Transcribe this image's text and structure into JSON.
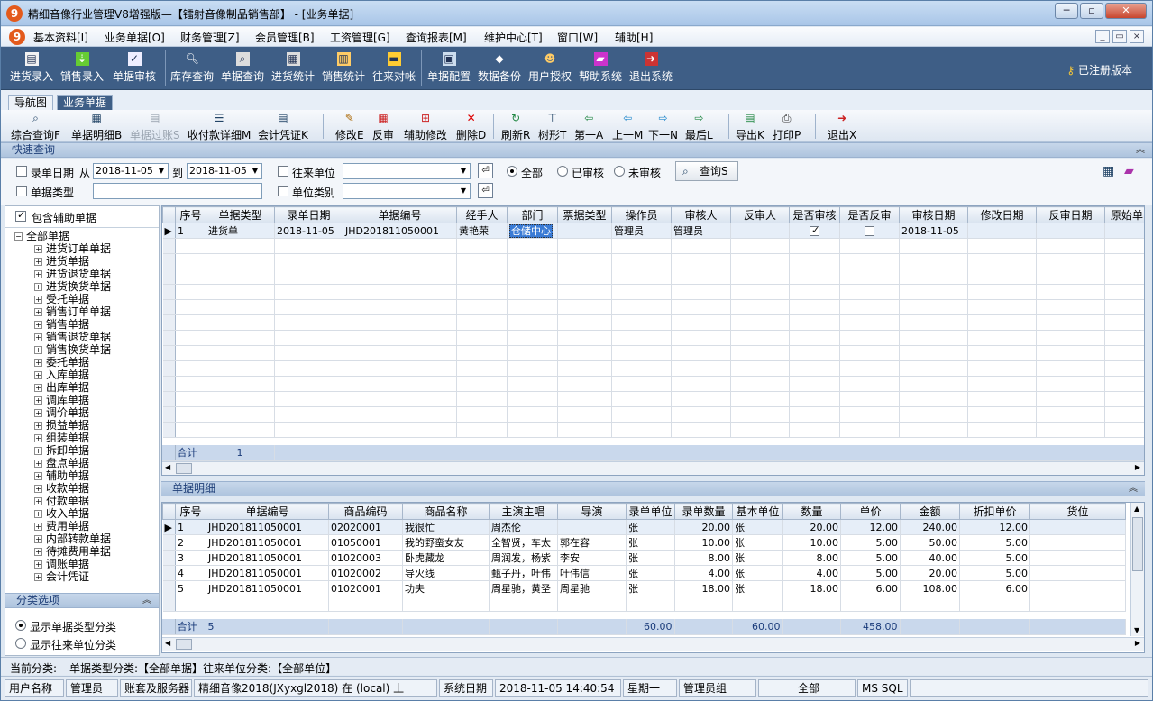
{
  "window": {
    "title": "精细音像行业管理V8增强版—【镭射音像制品销售部】 - [业务单据]",
    "app_icon": "9"
  },
  "menu": [
    "基本资料[I]",
    "业务单据[O]",
    "财务管理[Z]",
    "会员管理[B]",
    "工资管理[G]",
    "查询报表[M]",
    "维护中心[T]",
    "窗口[W]",
    "辅助[H]"
  ],
  "main_toolbar": [
    "进货录入",
    "销售录入",
    "单据审核",
    "库存查询",
    "单据查询",
    "进货统计",
    "销售统计",
    "往来对帐",
    "单据配置",
    "数据备份",
    "用户授权",
    "帮助系统",
    "退出系统"
  ],
  "registered_label": "已注册版本",
  "tabs": [
    "导航图",
    "业务单据"
  ],
  "doc_toolbar": [
    "综合查询F",
    "单据明细B",
    "单据过账S",
    "收付款详细M",
    "会计凭证K",
    "修改E",
    "反审",
    "辅助修改",
    "删除D",
    "刷新R",
    "树形T",
    "第一A",
    "上一M",
    "下一N",
    "最后L",
    "导出K",
    "打印P",
    "退出X"
  ],
  "quick_search": {
    "section_title": "快速查询",
    "date_label": "录单日期",
    "from_label": "从",
    "to_label": "到",
    "date_from": "2018-11-05",
    "date_to": "2018-11-05",
    "partner_label": "往来单位",
    "type_label": "单据类型",
    "unit_cat_label": "单位类别",
    "radio_all": "全部",
    "radio_audited": "已审核",
    "radio_unaudited": "未审核",
    "query_btn": "查询S"
  },
  "left_panel": {
    "include_aux": "包含辅助单据",
    "root": "全部单据",
    "items": [
      "进货订单单据",
      "进货单据",
      "进货退货单据",
      "进货换货单据",
      "受托单据",
      "销售订单单据",
      "销售单据",
      "销售退货单据",
      "销售换货单据",
      "委托单据",
      "入库单据",
      "出库单据",
      "调库单据",
      "调价单据",
      "损益单据",
      "组装单据",
      "拆卸单据",
      "盘点单据",
      "辅助单据",
      "收款单据",
      "付款单据",
      "收入单据",
      "费用单据",
      "内部转款单据",
      "待摊费用单据",
      "调账单据",
      "会计凭证"
    ],
    "category_title": "分类选项",
    "opt_type": "显示单据类型分类",
    "opt_partner": "显示往来单位分类"
  },
  "main_grid": {
    "columns": [
      "序号",
      "单据类型",
      "录单日期",
      "单据编号",
      "经手人",
      "部门",
      "票据类型",
      "操作员",
      "审核人",
      "反审人",
      "是否审核",
      "是否反审",
      "审核日期",
      "修改日期",
      "反审日期",
      "原始单"
    ],
    "row": {
      "no": "1",
      "type": "进货单",
      "date": "2018-11-05",
      "code": "JHD201811050001",
      "handler": "黄艳荣",
      "dept": "仓储中心",
      "bill_type": "",
      "operator": "管理员",
      "auditor": "管理员",
      "reverse": "",
      "audited": true,
      "reversed": false,
      "audit_date": "2018-11-05"
    },
    "sum_label": "合计",
    "sum_value": "1"
  },
  "detail": {
    "section_title": "单据明细",
    "columns": [
      "序号",
      "单据编号",
      "商品编码",
      "商品名称",
      "主演主唱",
      "导演",
      "录单单位",
      "录单数量",
      "基本单位",
      "数量",
      "单价",
      "金额",
      "折扣单价",
      "货位"
    ],
    "rows": [
      {
        "no": "1",
        "code": "JHD201811050001",
        "pcode": "02020001",
        "name": "我很忙",
        "star": "周杰伦",
        "director": "",
        "unit": "张",
        "qty": "20.00",
        "bunit": "张",
        "num": "20.00",
        "price": "12.00",
        "amount": "240.00",
        "dprice": "12.00"
      },
      {
        "no": "2",
        "code": "JHD201811050001",
        "pcode": "01050001",
        "name": "我的野蛮女友",
        "star": "全智贤，车太",
        "director": "郭在容",
        "unit": "张",
        "qty": "10.00",
        "bunit": "张",
        "num": "10.00",
        "price": "5.00",
        "amount": "50.00",
        "dprice": "5.00"
      },
      {
        "no": "3",
        "code": "JHD201811050001",
        "pcode": "01020003",
        "name": "卧虎藏龙",
        "star": "周润发，杨紫",
        "director": "李安",
        "unit": "张",
        "qty": "8.00",
        "bunit": "张",
        "num": "8.00",
        "price": "5.00",
        "amount": "40.00",
        "dprice": "5.00"
      },
      {
        "no": "4",
        "code": "JHD201811050001",
        "pcode": "01020002",
        "name": "导火线",
        "star": "甄子丹，叶伟",
        "director": "叶伟信",
        "unit": "张",
        "qty": "4.00",
        "bunit": "张",
        "num": "4.00",
        "price": "5.00",
        "amount": "20.00",
        "dprice": "5.00"
      },
      {
        "no": "5",
        "code": "JHD201811050001",
        "pcode": "01020001",
        "name": "功夫",
        "star": "周星驰，黄圣",
        "director": "周星驰",
        "unit": "张",
        "qty": "18.00",
        "bunit": "张",
        "num": "18.00",
        "price": "6.00",
        "amount": "108.00",
        "dprice": "6.00"
      }
    ],
    "sum_label": "合计",
    "sum_count": "5",
    "sum_qty": "60.00",
    "sum_num": "60.00",
    "sum_amount": "458.00"
  },
  "status1": {
    "label": "当前分类:",
    "value": "单据类型分类:【全部单据】往来单位分类:【全部单位】"
  },
  "status2": [
    "用户名称",
    "管理员",
    "账套及服务器",
    "精细音像2018(JXyxgl2018) 在 (local) 上",
    "系统日期",
    "2018-11-05  14:40:54",
    "星期一",
    "管理员组",
    "全部",
    "MS SQL"
  ]
}
